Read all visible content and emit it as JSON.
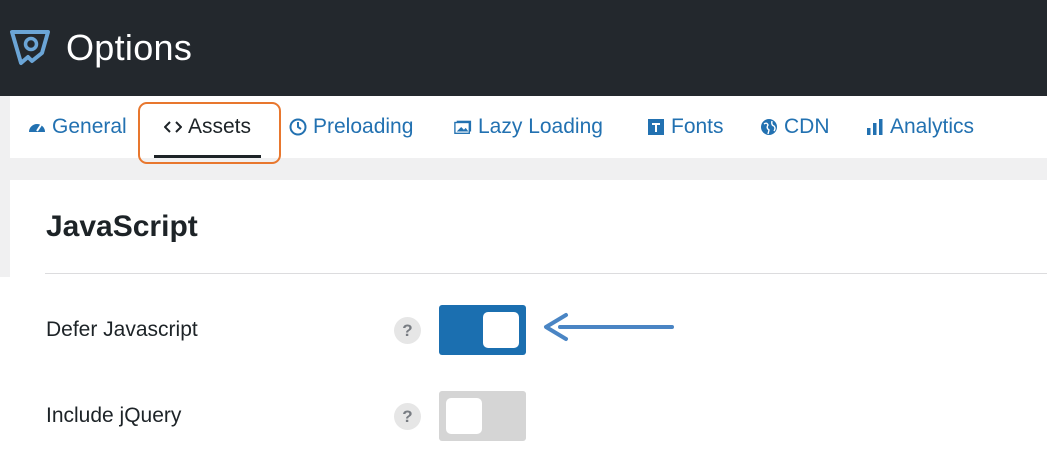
{
  "header": {
    "title": "Options"
  },
  "tabs": [
    {
      "label": "General",
      "icon": "dashboard-icon"
    },
    {
      "label": "Assets",
      "icon": "code-icon",
      "active": true
    },
    {
      "label": "Preloading",
      "icon": "clock-icon"
    },
    {
      "label": "Lazy Loading",
      "icon": "image-icon"
    },
    {
      "label": "Fonts",
      "icon": "fonts-icon"
    },
    {
      "label": "CDN",
      "icon": "globe-icon"
    },
    {
      "label": "Analytics",
      "icon": "chart-icon"
    }
  ],
  "section": {
    "title": "JavaScript"
  },
  "settings": [
    {
      "label": "Defer Javascript",
      "help": "?",
      "enabled": true
    },
    {
      "label": "Include jQuery",
      "help": "?",
      "enabled": false
    }
  ],
  "colors": {
    "header_bg": "#23282d",
    "link": "#2271b1",
    "toggle_on": "#1b6fb0",
    "toggle_off": "#d5d5d5",
    "highlight": "#e8772e",
    "arrow": "#4a85c4"
  }
}
